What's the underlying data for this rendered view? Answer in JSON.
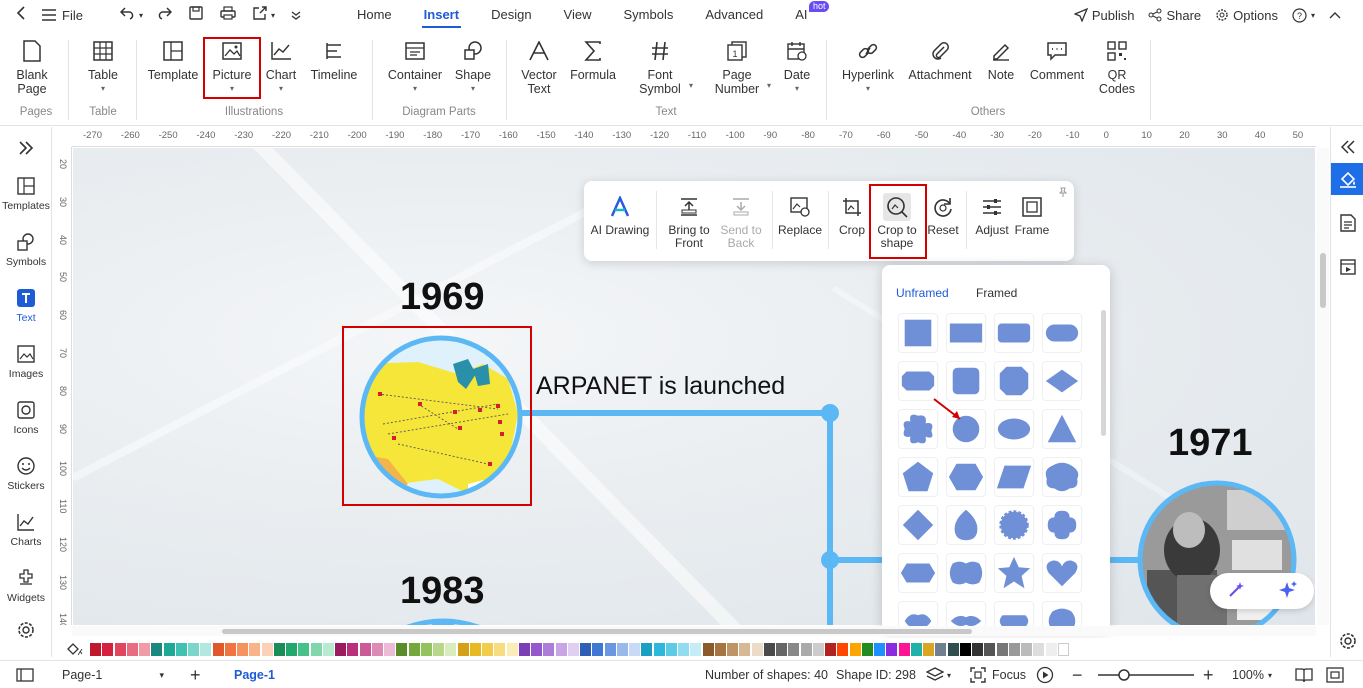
{
  "menu": {
    "file_label": "File",
    "tabs": [
      {
        "label": "Home",
        "active": false
      },
      {
        "label": "Insert",
        "active": true
      },
      {
        "label": "Design",
        "active": false
      },
      {
        "label": "View",
        "active": false
      },
      {
        "label": "Symbols",
        "active": false
      },
      {
        "label": "Advanced",
        "active": false
      },
      {
        "label": "AI",
        "active": false,
        "badge": "hot"
      }
    ],
    "right": {
      "publish": "Publish",
      "share": "Share",
      "options": "Options"
    }
  },
  "ribbon": {
    "blank_page": "Blank Page",
    "table": "Table",
    "template": "Template",
    "picture": "Picture",
    "chart": "Chart",
    "timeline": "Timeline",
    "container": "Container",
    "shape": "Shape",
    "vector_text": "Vector Text",
    "formula": "Formula",
    "font_symbol": "Font Symbol",
    "page_number": "Page Number",
    "date": "Date",
    "hyperlink": "Hyperlink",
    "attachment": "Attachment",
    "note": "Note",
    "comment": "Comment",
    "qr_codes": "QR Codes",
    "groups": {
      "pages": "Pages",
      "table": "Table",
      "illustrations": "Illustrations",
      "diagram_parts": "Diagram Parts",
      "text": "Text",
      "others": "Others"
    }
  },
  "left_sidebar": {
    "templates": "Templates",
    "symbols": "Symbols",
    "text": "Text",
    "images": "Images",
    "icons": "Icons",
    "stickers": "Stickers",
    "charts": "Charts",
    "widgets": "Widgets"
  },
  "ruler": {
    "h": [
      "-270",
      "-260",
      "-250",
      "-240",
      "-230",
      "-220",
      "-210",
      "-200",
      "-190",
      "-180",
      "-170",
      "-160",
      "-150",
      "-140",
      "-130",
      "-120",
      "-110",
      "-100",
      "-90",
      "-80",
      "-70",
      "-60",
      "-50",
      "-40",
      "-30",
      "-20",
      "-10",
      "0",
      "10",
      "20",
      "30",
      "40",
      "50"
    ],
    "v": [
      "20",
      "30",
      "40",
      "50",
      "60",
      "70",
      "80",
      "90",
      "100",
      "110",
      "120",
      "130",
      "140"
    ]
  },
  "canvas": {
    "year_1969": "1969",
    "event_1969": "ARPANET is launched",
    "year_1971": "1971",
    "year_1983": "1983"
  },
  "image_toolbar": {
    "ai_drawing": "AI Drawing",
    "bring_to_front": "Bring to Front",
    "send_to_back": "Send to Back",
    "replace": "Replace",
    "crop": "Crop",
    "crop_to_shape": "Crop to shape",
    "reset": "Reset",
    "adjust": "Adjust",
    "frame": "Frame"
  },
  "shape_panel": {
    "tab_unframed": "Unframed",
    "tab_framed": "Framed",
    "shape_color": "#6f8fd6"
  },
  "colors": {
    "accent": "#1e5bd6",
    "highlight": "#d40000",
    "timeline": "#5bb8f5",
    "swatches": [
      "#c0172c",
      "#d4213f",
      "#e0465e",
      "#e96d80",
      "#f19aa8",
      "#19887e",
      "#1ea896",
      "#3fc2b1",
      "#7ad6ca",
      "#b3e8e1",
      "#e0582b",
      "#f07440",
      "#f5925f",
      "#f9b28a",
      "#fbd1b8",
      "#1a8c5a",
      "#22a86d",
      "#46c189",
      "#7fd7ab",
      "#b6ebcf",
      "#9b1b5e",
      "#b8307a",
      "#cc5a96",
      "#dd8bb6",
      "#ecbcd6",
      "#5b8c2a",
      "#74a83a",
      "#94c25c",
      "#b7d88b",
      "#d8ecbd",
      "#d4a017",
      "#e8b923",
      "#f2cc4c",
      "#f8dd80",
      "#fcecb7",
      "#7a3fb5",
      "#9457cc",
      "#ad7ed9",
      "#c8a6e6",
      "#e1cff2",
      "#2e5fb8",
      "#3f77d4",
      "#6a97e0",
      "#99b9eb",
      "#c8daf5",
      "#1a9fc4",
      "#2bb8dc",
      "#5ccbe6",
      "#91dcef",
      "#c5edf7",
      "#8a5a2b",
      "#a67440",
      "#bf9466",
      "#d6b895",
      "#ebdbc7",
      "#4a4a4a",
      "#666666",
      "#888888",
      "#aaaaaa",
      "#cccccc",
      "#b22222",
      "#ff4500",
      "#ffa500",
      "#228b22",
      "#1e90ff",
      "#8a2be2",
      "#ff1493",
      "#20b2aa",
      "#daa520",
      "#708090",
      "#2f4f4f",
      "#000000",
      "#333333",
      "#555555",
      "#777777",
      "#999999",
      "#bbbbbb",
      "#dddddd",
      "#eeeeee",
      "#ffffff"
    ]
  },
  "status": {
    "page_select": "Page-1",
    "page_tab": "Page-1",
    "num_shapes": "Number of shapes: 40",
    "shape_id": "Shape ID: 298",
    "focus": "Focus",
    "zoom": "100%"
  }
}
